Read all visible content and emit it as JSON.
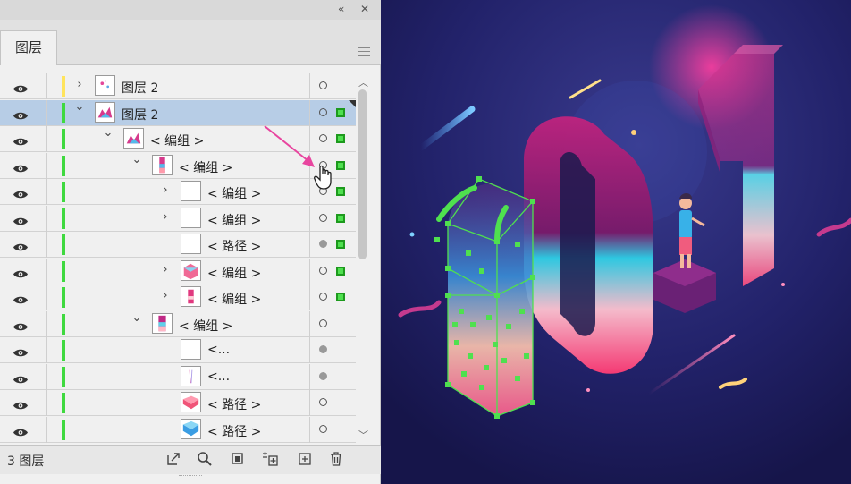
{
  "panel": {
    "tab_label": "图层",
    "collapse_icon": "«",
    "close_icon": "✕",
    "layer_count": "3 图层"
  },
  "rows": [
    {
      "name": "图层 2",
      "level": 0,
      "arrow": "›",
      "bar": "#ffe45c",
      "selected": false,
      "target_filled": false,
      "sel_box": false
    },
    {
      "name": "图层 2",
      "level": 0,
      "arrow": "⌄",
      "bar": "#3fd93f",
      "selected": true,
      "target_filled": false,
      "sel_box": true
    },
    {
      "name": "< 编组 >",
      "level": 1,
      "arrow": "⌄",
      "bar": "#3fd93f",
      "selected": false,
      "target_filled": false,
      "sel_box": true
    },
    {
      "name": "< 编组 >",
      "level": 2,
      "arrow": "⌄",
      "bar": "#3fd93f",
      "selected": false,
      "target_filled": false,
      "sel_box": true
    },
    {
      "name": "< 编组 >",
      "level": 3,
      "arrow": "›",
      "bar": "#3fd93f",
      "selected": false,
      "target_filled": false,
      "sel_box": true
    },
    {
      "name": "< 编组 >",
      "level": 3,
      "arrow": "›",
      "bar": "#3fd93f",
      "selected": false,
      "target_filled": false,
      "sel_box": true
    },
    {
      "name": "< 路径 >",
      "level": 3,
      "arrow": "",
      "bar": "#3fd93f",
      "selected": false,
      "target_filled": true,
      "sel_box": true
    },
    {
      "name": "< 编组 >",
      "level": 3,
      "arrow": "›",
      "bar": "#3fd93f",
      "selected": false,
      "target_filled": false,
      "sel_box": true
    },
    {
      "name": "< 编组 >",
      "level": 3,
      "arrow": "›",
      "bar": "#3fd93f",
      "selected": false,
      "target_filled": false,
      "sel_box": true
    },
    {
      "name": "< 编组 >",
      "level": 2,
      "arrow": "⌄",
      "bar": "#3fd93f",
      "selected": false,
      "target_filled": false,
      "sel_box": false
    },
    {
      "name": "<...",
      "level": 3,
      "arrow": "",
      "bar": "#3fd93f",
      "selected": false,
      "target_filled": true,
      "sel_box": false
    },
    {
      "name": "<...",
      "level": 3,
      "arrow": "",
      "bar": "#3fd93f",
      "selected": false,
      "target_filled": true,
      "sel_box": false
    },
    {
      "name": "< 路径 >",
      "level": 3,
      "arrow": "",
      "bar": "#3fd93f",
      "selected": false,
      "target_filled": false,
      "sel_box": false
    },
    {
      "name": "< 路径 >",
      "level": 3,
      "arrow": "",
      "bar": "#3fd93f",
      "selected": false,
      "target_filled": false,
      "sel_box": false
    }
  ],
  "colors": {
    "selection_green": "#4fe04f",
    "row_selected": "#b7cde6",
    "pointer_arrow": "#e8459f",
    "canvas_bg": "#1b1a4e"
  },
  "bottom_tools": [
    "export-icon",
    "locate-object-icon",
    "make-clipping-mask-icon",
    "new-sublayer-icon",
    "new-layer-icon",
    "trash-icon"
  ]
}
